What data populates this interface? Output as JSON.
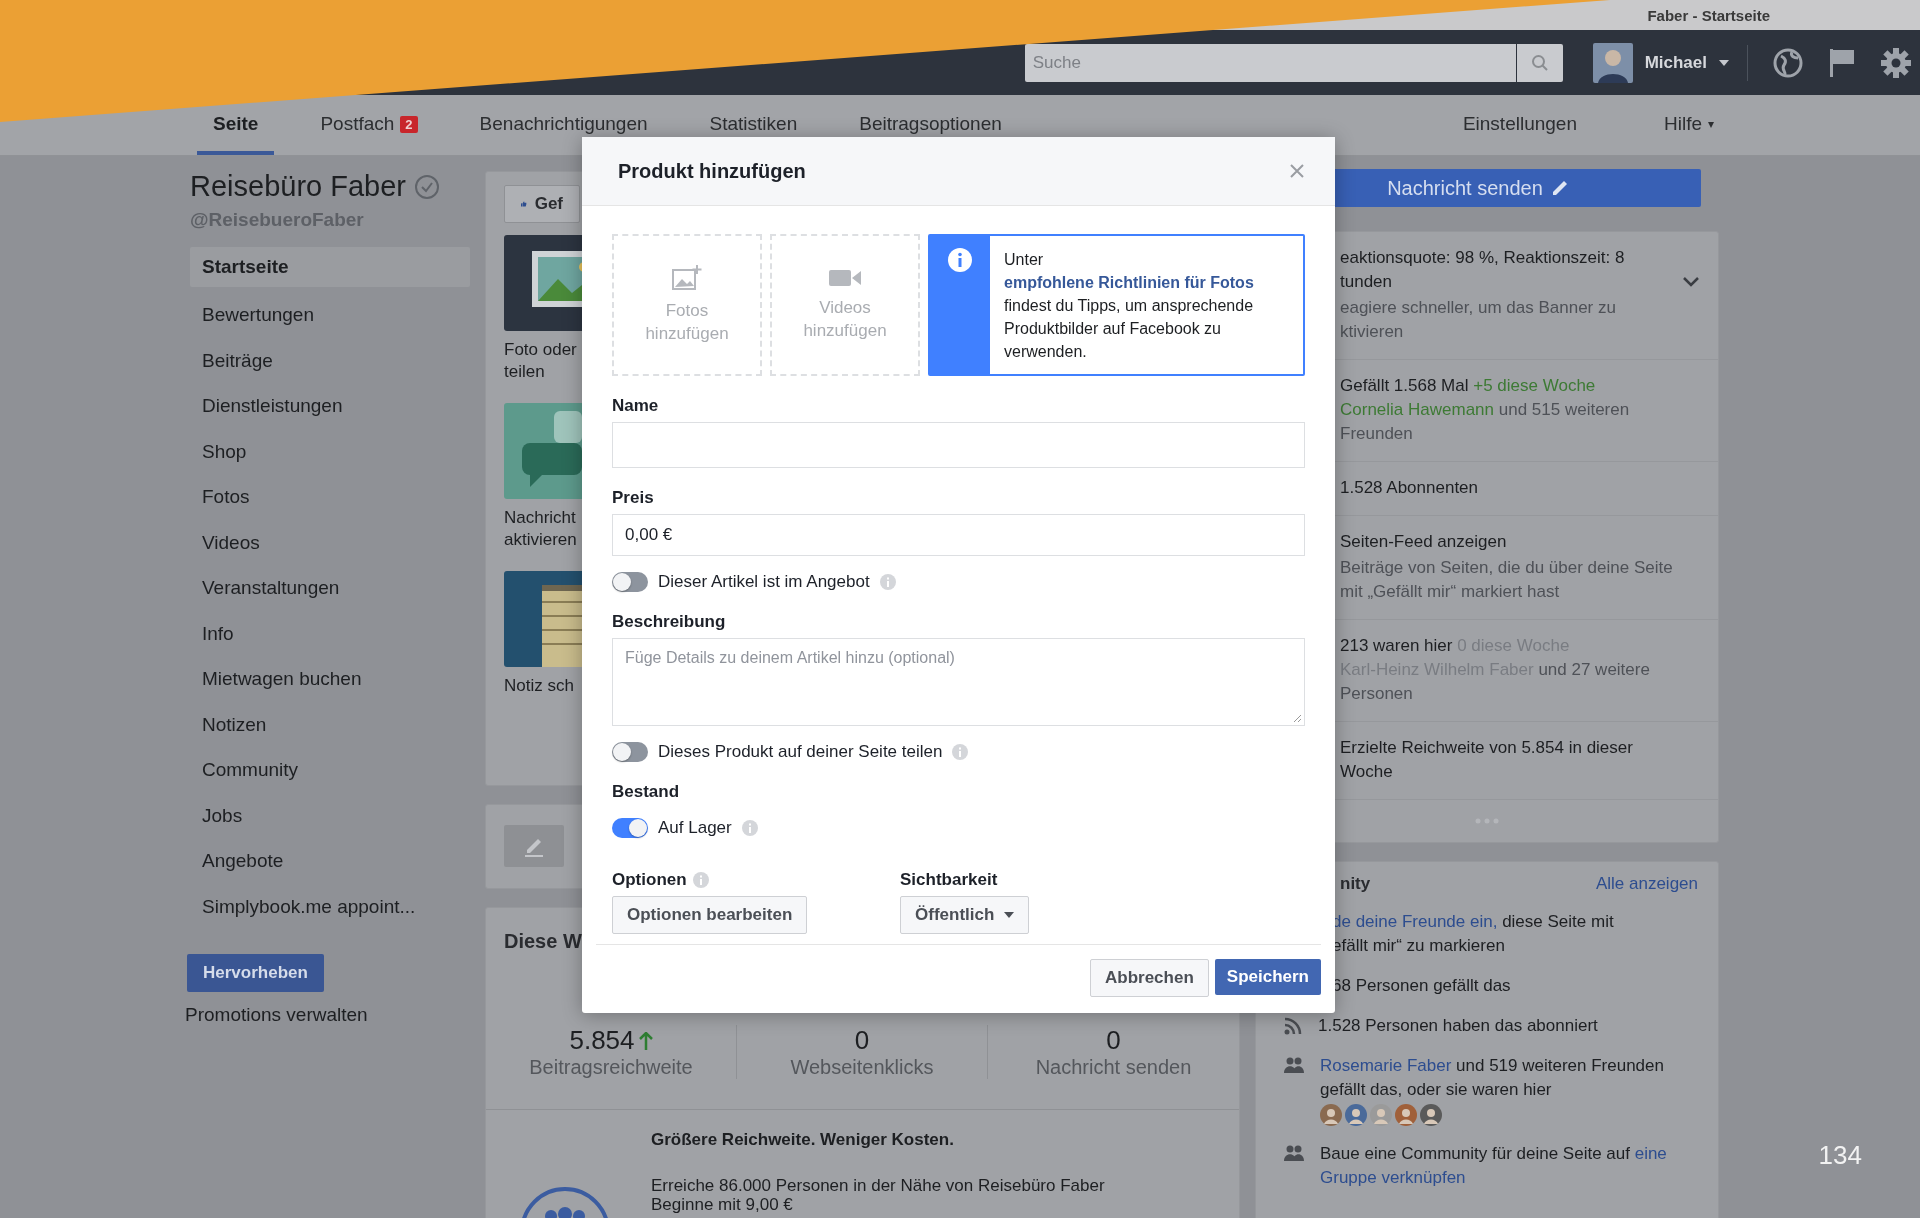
{
  "window": {
    "title": "Faber - Startseite"
  },
  "top_bar": {
    "search": {
      "placeholder": "Suche"
    },
    "user": {
      "name": "Michael"
    }
  },
  "tabs": [
    {
      "label": "Seite",
      "selected": true
    },
    {
      "label": "Postfach",
      "badge": "2",
      "selected": false
    },
    {
      "label": "Benachrichtigungen",
      "selected": false
    },
    {
      "label": "Statistiken",
      "selected": false
    },
    {
      "label": "Beitragsoptionen",
      "selected": false
    }
  ],
  "right_tabs": [
    {
      "label": "Einstellungen"
    },
    {
      "label": "Hilfe",
      "caret": "▾"
    }
  ],
  "page": {
    "name": "Reisebüro Faber",
    "verified": true,
    "handle": "@ReisebueroFaber"
  },
  "sidebar": {
    "items": [
      {
        "label": "Startseite",
        "selected": true
      },
      {
        "label": "Bewertungen",
        "selected": false
      },
      {
        "label": "Beiträge",
        "selected": false
      },
      {
        "label": "Dienstleistungen",
        "selected": false
      },
      {
        "label": "Shop",
        "selected": false
      },
      {
        "label": "Fotos",
        "selected": false
      },
      {
        "label": "Videos",
        "selected": false
      },
      {
        "label": "Veranstaltungen",
        "selected": false
      },
      {
        "label": "Info",
        "selected": false
      },
      {
        "label": "Mietwagen buchen",
        "selected": false
      },
      {
        "label": "Notizen",
        "selected": false
      },
      {
        "label": "Community",
        "selected": false
      },
      {
        "label": "Jobs",
        "selected": false
      },
      {
        "label": "Angebote",
        "selected": false
      },
      {
        "label": "Simplybook.me appoint...",
        "selected": false
      }
    ],
    "promote_button": "Hervorheben",
    "manage_link": "Promotions verwalten"
  },
  "composer": {
    "like_button": "Gef",
    "actions": [
      {
        "kind": "photo",
        "lines": [
          "Foto oder",
          "teilen"
        ]
      },
      {
        "kind": "chat",
        "lines": [
          "Nachricht",
          "aktivieren"
        ]
      },
      {
        "kind": "note",
        "lines": [
          "Notiz sch"
        ]
      }
    ]
  },
  "insights": {
    "title": "Diese W",
    "stats": [
      {
        "kind": "rising",
        "value": "5.854",
        "label": "Beitragsreichweite"
      },
      {
        "kind": "plain",
        "value": "0",
        "label": "Webseitenklicks"
      },
      {
        "kind": "plain",
        "value": "0",
        "label": "Nachricht senden"
      }
    ]
  },
  "promo": {
    "title": "Größere Reichweite. Weniger Kosten.",
    "text": "Erreiche 86.000 Personen in der Nähe von Reisebüro Faber",
    "subtext": "Beginne mit 9,00 €"
  },
  "right": {
    "message_button": "Nachricht senden",
    "info_rows": [
      {
        "expanded": false,
        "paragraphs": [
          [
            [
              {
                "text": "eaktionsquote: 98 %, Reaktionszeit: 8",
                "kind": "normal"
              }
            ],
            [
              {
                "text": "tunden",
                "kind": "normal"
              }
            ]
          ],
          [
            [
              {
                "text": "eagiere schneller, um das Banner zu",
                "kind": "muted"
              }
            ],
            [
              {
                "text": "ktivieren",
                "kind": "muted"
              }
            ]
          ]
        ]
      },
      {
        "paragraphs": [
          [
            [
              {
                "text": "Gefällt 1.568 Mal ",
                "kind": "normal"
              },
              {
                "text": "+5 diese Woche",
                "kind": "green"
              }
            ],
            [
              {
                "text": "Cornelia Hawemann",
                "kind": "green"
              },
              {
                "text": " und 515 weiteren",
                "kind": "muted"
              }
            ],
            [
              {
                "text": "Freunden",
                "kind": "muted"
              }
            ]
          ]
        ]
      },
      {
        "paragraphs": [
          [
            [
              {
                "text": "1.528 Abonnenten",
                "kind": "normal"
              }
            ]
          ]
        ]
      },
      {
        "paragraphs": [
          [
            [
              {
                "text": "Seiten-Feed anzeigen",
                "kind": "normal"
              }
            ]
          ],
          [
            [
              {
                "text": "Beiträge von Seiten, die du über deine Seite",
                "kind": "muted"
              }
            ],
            [
              {
                "text": "mit „Gefällt mir“ markiert hast",
                "kind": "muted"
              }
            ]
          ]
        ]
      },
      {
        "paragraphs": [
          [
            [
              {
                "text": "213 waren hier ",
                "kind": "normal"
              },
              {
                "text": "0 diese Woche",
                "kind": "faint"
              }
            ],
            [
              {
                "text": "Karl-Heinz Wilhelm Faber",
                "kind": "faint"
              },
              {
                "text": " und 27 weitere",
                "kind": "muted"
              }
            ],
            [
              {
                "text": "Personen",
                "kind": "muted"
              }
            ]
          ]
        ]
      },
      {
        "paragraphs": [
          [
            [
              {
                "text": "Erzielte Reichweite von 5.854 in dieser",
                "kind": "normal"
              }
            ],
            [
              {
                "text": "Woche",
                "kind": "normal"
              }
            ]
          ]
        ]
      }
    ],
    "community": {
      "title": "nity",
      "link": "Alle anzeigen",
      "rows": [
        {
          "kind": "cut",
          "lines": [
            [
              {
                "text": "de deine Freunde ein,",
                "kind": "link"
              },
              {
                "text": " diese Seite mit",
                "kind": "normal"
              }
            ],
            [
              {
                "text": "efällt mir“ zu markieren",
                "kind": "normal"
              }
            ]
          ]
        },
        {
          "kind": "cut",
          "lines": [
            [
              {
                "text": "68 Personen gefällt das",
                "kind": "normal"
              }
            ]
          ]
        },
        {
          "kind": "subscribers",
          "lines": [
            [
              {
                "text": "1.528 Personen haben das abonniert",
                "kind": "normal"
              }
            ]
          ]
        },
        {
          "kind": "friends",
          "lines": [
            [
              {
                "text": "Rosemarie Faber",
                "kind": "link"
              },
              {
                "text": " und 519 weiteren Freunden",
                "kind": "normal"
              }
            ],
            [
              {
                "text": "gefällt das, oder sie waren hier",
                "kind": "normal"
              }
            ]
          ]
        },
        {
          "kind": "group",
          "lines": [
            [
              {
                "text": "Baue eine Community für deine Seite auf ",
                "kind": "normal"
              },
              {
                "text": "eine",
                "kind": "link"
              }
            ],
            [
              {
                "text": "Gruppe verknüpfen",
                "kind": "link"
              }
            ]
          ]
        }
      ]
    }
  },
  "modal": {
    "title": "Produkt hinzufügen",
    "uploads": [
      {
        "kind": "photo",
        "label": "Fotos hinzufügen"
      },
      {
        "kind": "video",
        "label": "Videos hinzufügen"
      }
    ],
    "tip": [
      {
        "text": "Unter ",
        "kind": "normal"
      },
      {
        "text": "empfohlene Richtlinien für Fotos",
        "kind": "link"
      },
      {
        "text": " findest du Tipps, um ansprechende Produktbilder auf Facebook zu verwenden.",
        "kind": "normal"
      }
    ],
    "form": [
      {
        "kind": "field",
        "label": "Name"
      },
      {
        "kind": "field",
        "label": "Preis",
        "value": "0,00 €"
      },
      {
        "kind": "toggle",
        "label": "Dieser Artikel ist im Angebot",
        "on": false
      },
      {
        "kind": "textarea",
        "label": "Beschreibung",
        "placeholder": "Füge Details zu deinem Artikel hinzu (optional)"
      },
      {
        "kind": "toggle",
        "label": "Dieses Produkt auf deiner Seite teilen",
        "on": false
      },
      {
        "kind": "heading",
        "label": "Bestand"
      },
      {
        "kind": "toggle",
        "label": "Auf Lager",
        "on": true
      }
    ],
    "options": {
      "label": "Optionen",
      "button": "Optionen bearbeiten"
    },
    "visibility": {
      "label": "Sichtbarkeit",
      "value": "Öffentlich"
    },
    "cancel": "Abbrechen",
    "save": "Speichern"
  },
  "slide_number": "134"
}
